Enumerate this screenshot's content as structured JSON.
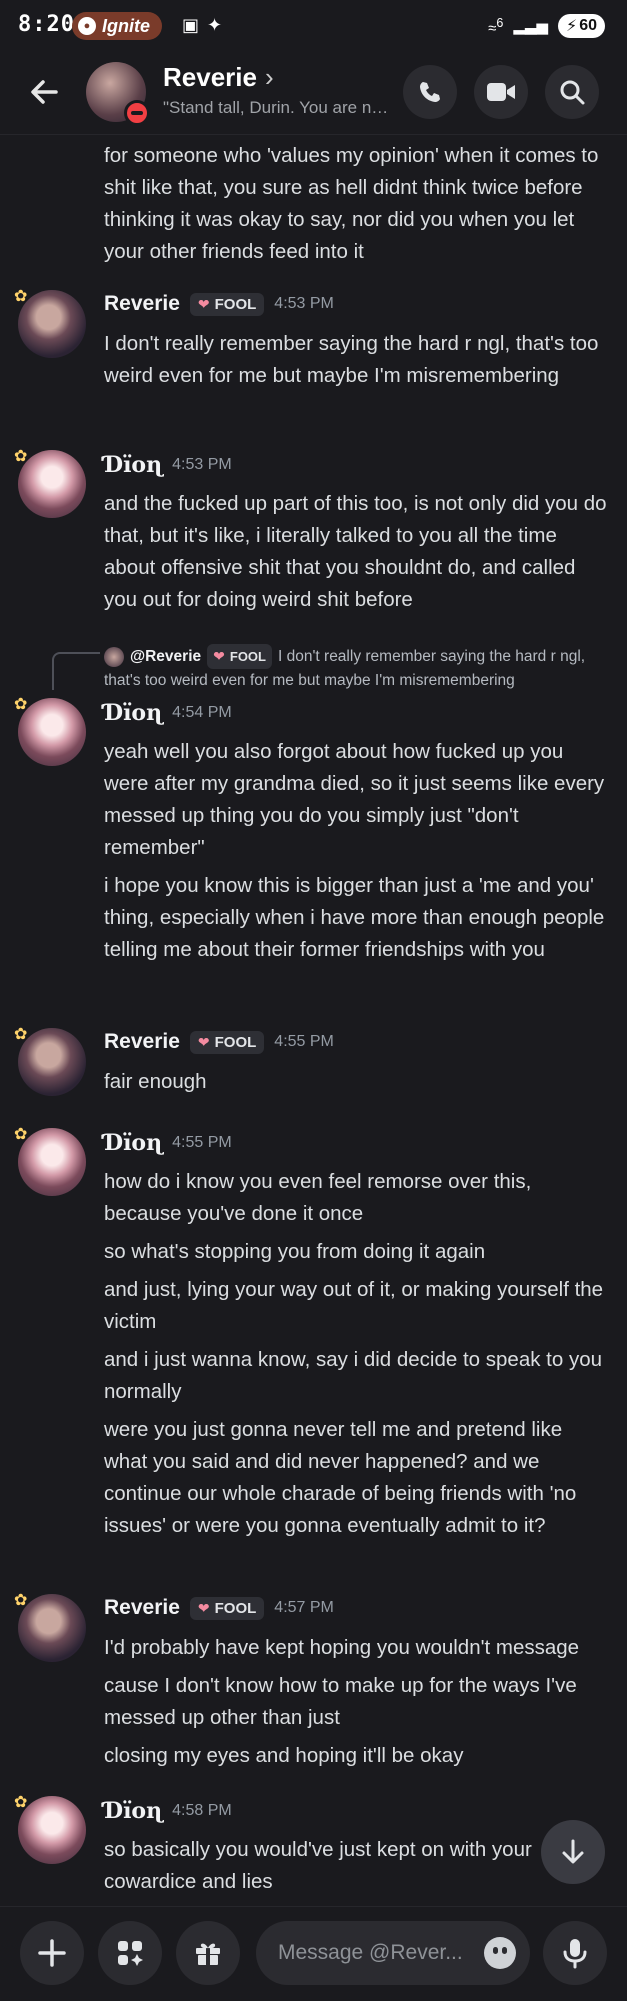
{
  "status_bar": {
    "time": "8:20",
    "pill_label": "Ignite",
    "battery": "60",
    "signal_label": "6"
  },
  "header": {
    "name": "Reverie",
    "status": "\"Stand tall, Durin. You are no...",
    "icons": [
      "back-arrow-icon",
      "call-icon",
      "video-icon",
      "search-icon"
    ]
  },
  "messages": [
    {
      "paragraphs": [
        "for someone who 'values my opinion' when it comes to shit like that, you sure as hell didnt think twice before thinking it was okay to say, nor did you when you let your other friends feed into it"
      ]
    },
    {
      "author": "Reverie",
      "tag": "FOOL",
      "time": "4:53 PM",
      "paragraphs": [
        "I don't really remember saying the hard r ngl, that's too weird even for me but maybe I'm misremembering"
      ]
    },
    {
      "author": "Ɗïоɳ",
      "time": "4:53 PM",
      "paragraphs": [
        "and the fucked up part of this too, is not only did you do that, but it's like, i literally talked to you all the time about offensive shit that you shouldnt do, and called you out for doing weird shit before"
      ]
    },
    {
      "author": "Ɗïоɳ",
      "time": "4:54 PM",
      "reply": {
        "author": "@Reverie",
        "tag": "FOOL",
        "text": "I don't really remember saying the hard r ngl, that's too weird even for me but maybe I'm misremembering"
      },
      "paragraphs": [
        "yeah well you also forgot about how fucked up you were after my grandma died, so it just seems like every messed up thing you do you simply just \"don't remember\"",
        "i hope you know this is bigger than just a 'me and you' thing, especially when i have more than enough people telling me about their former friendships with you"
      ]
    },
    {
      "author": "Reverie",
      "tag": "FOOL",
      "time": "4:55 PM",
      "paragraphs": [
        "fair enough"
      ]
    },
    {
      "author": "Ɗïоɳ",
      "time": "4:55 PM",
      "paragraphs": [
        "how do i know you even feel remorse over this, because you've done it once",
        "so what's stopping you from doing it again",
        "and just, lying your way out of it, or making yourself the victim",
        "and i just wanna know, say i did decide to speak to you normally",
        "were you just gonna never tell me and pretend like what you said and did never happened? and we continue our whole charade of being friends with 'no issues' or were you gonna eventually admit to it?"
      ]
    },
    {
      "author": "Reverie",
      "tag": "FOOL",
      "time": "4:57 PM",
      "paragraphs": [
        "I'd probably have kept hoping you wouldn't message",
        "cause I don't know how to make up for the ways I've messed up other than just",
        "closing my eyes and hoping it'll be okay"
      ]
    },
    {
      "author": "Ɗïоɳ",
      "time": "4:58 PM",
      "paragraphs": [
        "so basically you would've just kept on with your cowardice and lies"
      ]
    }
  ],
  "composer": {
    "placeholder": "Message @Rever..."
  }
}
